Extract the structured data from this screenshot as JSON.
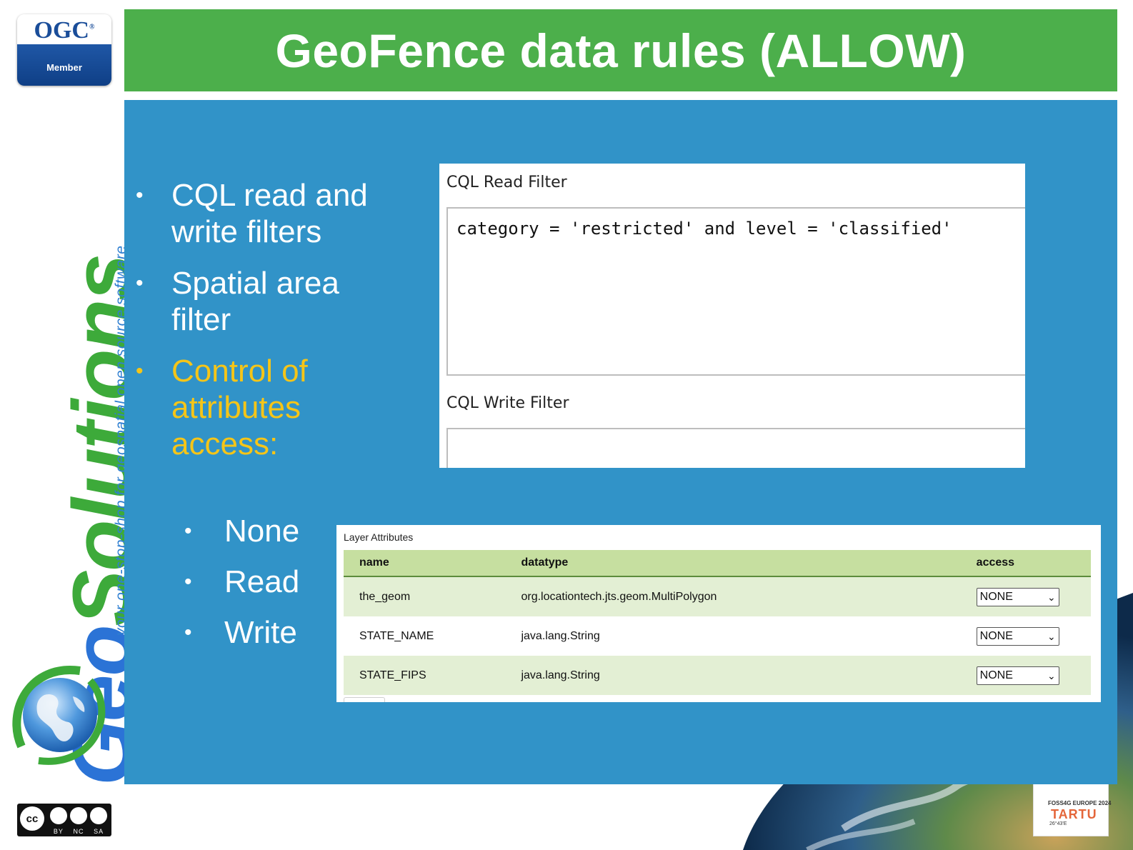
{
  "slide": {
    "title": "GeoFence data rules (ALLOW)"
  },
  "branding": {
    "ogc_badge_text": "OGC",
    "ogc_badge_sub": "Member",
    "brand_geo": "Geo",
    "brand_solutions": "Solutions",
    "brand_tagline": "your one-stop-shop for geospatial open source software",
    "license": {
      "main": "cc",
      "labels": [
        "BY",
        "NC",
        "SA"
      ]
    },
    "event_logo": {
      "line1": "FOSS4G EUROPE 2024",
      "line2": "TARTU",
      "line3": "26°43'E"
    }
  },
  "bullets": {
    "items": [
      {
        "text": "CQL read and write filters"
      },
      {
        "text": "Spatial area filter"
      },
      {
        "text": "Control of attributes access:"
      }
    ],
    "sub_items": [
      {
        "text": "None"
      },
      {
        "text": "Read"
      },
      {
        "text": "Write"
      }
    ]
  },
  "cql": {
    "read_label": "CQL Read Filter",
    "read_value": "category = 'restricted' and level = 'classified'",
    "write_label": "CQL Write Filter",
    "write_value": ""
  },
  "layer_attributes": {
    "title": "Layer Attributes",
    "columns": [
      "name",
      "datatype",
      "access"
    ],
    "rows": [
      {
        "name": "the_geom",
        "datatype": "org.locationtech.jts.geom.MultiPolygon",
        "access": "NONE"
      },
      {
        "name": "STATE_NAME",
        "datatype": "java.lang.String",
        "access": "NONE"
      },
      {
        "name": "STATE_FIPS",
        "datatype": "java.lang.String",
        "access": "NONE"
      }
    ]
  },
  "colors": {
    "title_bar": "#4caf4b",
    "content_panel": "#3193c8",
    "highlight_text": "#f5c518",
    "table_header": "#c6dfa0",
    "table_odd_row": "#e3efd4"
  }
}
